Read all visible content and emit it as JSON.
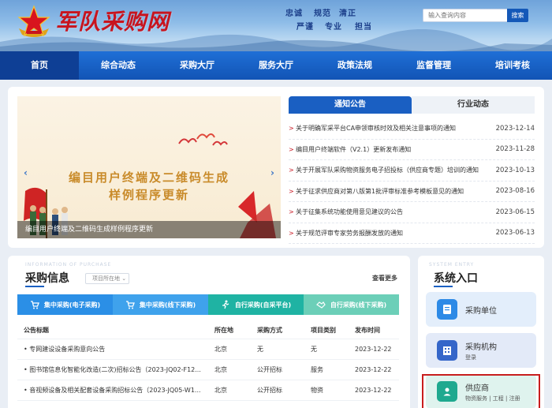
{
  "header": {
    "logo_text": "军队采购网",
    "slogan_row1": [
      "忠诚",
      "规范",
      "清正"
    ],
    "slogan_row2": [
      "严谨",
      "专业",
      "担当"
    ],
    "search_placeholder": "输入查询内容",
    "search_button": "搜索"
  },
  "nav": {
    "items": [
      {
        "label": "首页",
        "active": true
      },
      {
        "label": "综合动态"
      },
      {
        "label": "采购大厅"
      },
      {
        "label": "服务大厅"
      },
      {
        "label": "政策法规"
      },
      {
        "label": "监督管理"
      },
      {
        "label": "培训考核"
      }
    ]
  },
  "carousel": {
    "title_line1": "编目用户终端及二维码生成",
    "title_line2": "样例程序更新",
    "caption": "编目用户终端及二维码生成样例程序更新",
    "prev": "‹",
    "next": "›"
  },
  "notices": {
    "tabs": [
      "通知公告",
      "行业动态"
    ],
    "items": [
      {
        "title": "关于明确军采平台CA申领审核时效及相关注意事项的通知",
        "date": "2023-12-14"
      },
      {
        "title": "编目用户终端软件（V2.1）更新发布通知",
        "date": "2023-11-28"
      },
      {
        "title": "关于开展军队采购物资服务电子招投标（供应商专题）培训的通知",
        "date": "2023-10-13"
      },
      {
        "title": "关于征求供应商对第八版第1批评审标准参考模板意见的通知",
        "date": "2023-08-16"
      },
      {
        "title": "关于征集系统功能使用意见建议的公告",
        "date": "2023-06-15"
      },
      {
        "title": "关于规范评审专家劳务报酬发放的通知",
        "date": "2023-06-13"
      }
    ],
    "bullet": ">"
  },
  "purchase_info": {
    "watermark": "INFORMATION OF PURCHASE",
    "title": "采购信息",
    "region_select": "项目所在地",
    "more": "查看更多",
    "categories": [
      {
        "label": "集中采购(电子采购)",
        "color": "#2b8fe6"
      },
      {
        "label": "集中采购(线下采购)",
        "color": "#3fa2ec"
      },
      {
        "label": "自行采购(自采平台)",
        "color": "#1fb3a3"
      },
      {
        "label": "自行采购(线下采购)",
        "color": "#6ccfb8"
      }
    ],
    "columns": [
      "公告标题",
      "所在地",
      "采购方式",
      "项目类别",
      "发布时间"
    ],
    "rows": [
      {
        "title": "专网建设设备采购意向公告",
        "loc": "北京",
        "method": "无",
        "type": "无",
        "date": "2023-12-22"
      },
      {
        "title": "图书馆信息化智能化改造(二次)招标公告（2023-JQ02-F12...",
        "loc": "北京",
        "method": "公开招标",
        "type": "服务",
        "date": "2023-12-22"
      },
      {
        "title": "音视频设备及相关配套设备采购招标公告（2023-JQ05-W1...",
        "loc": "北京",
        "method": "公开招标",
        "type": "物资",
        "date": "2023-12-22"
      }
    ]
  },
  "system_entry": {
    "watermark": "SYSTEM ENTRY",
    "title": "系统入口",
    "items": [
      {
        "name": "采购单位",
        "sub": ""
      },
      {
        "name": "采购机构",
        "sub": "登录"
      },
      {
        "name": "供应商",
        "sub": "物资服务 | 工程 | 注册"
      }
    ]
  }
}
